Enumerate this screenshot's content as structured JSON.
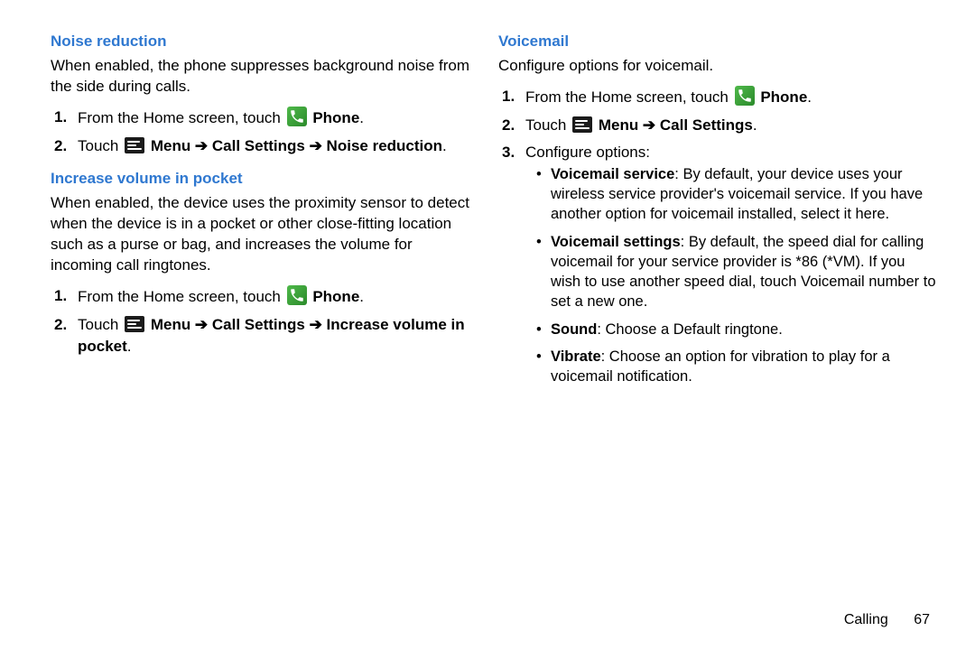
{
  "left": {
    "noise": {
      "heading": "Noise reduction",
      "desc": "When enabled, the phone suppresses background noise from the side during calls.",
      "step1_a": "From the Home screen, touch ",
      "step1_b": "Phone",
      "step2_a": "Touch ",
      "step2_b": "Menu ➔ Call Settings ➔ Noise reduction"
    },
    "pocket": {
      "heading": "Increase volume in pocket",
      "desc": "When enabled, the device uses the proximity sensor to detect when the device is in a pocket or other close-fitting location such as a purse or bag, and increases the volume for incoming call ringtones.",
      "step1_a": "From the Home screen, touch ",
      "step1_b": "Phone",
      "step2_a": "Touch ",
      "step2_b": "Menu ➔ Call Settings ➔ Increase volume in pocket"
    }
  },
  "right": {
    "heading": "Voicemail",
    "desc": "Configure options for voicemail.",
    "step1_a": "From the Home screen, touch ",
    "step1_b": "Phone",
    "step2_a": "Touch ",
    "step2_b": "Menu ➔ Call Settings",
    "step3": "Configure options:",
    "bullets": {
      "b1_label": "Voicemail service",
      "b1_text": ": By default, your device uses your wireless service provider's voicemail service. If you have another option for voicemail installed, select it here.",
      "b2_label": "Voicemail settings",
      "b2_text": ": By default, the speed dial for calling voicemail for your service provider is *86 (*VM). If you wish to use another speed dial, touch Voicemail number to set a new one.",
      "b3_label": "Sound",
      "b3_text": ": Choose a Default ringtone.",
      "b4_label": "Vibrate",
      "b4_text": ": Choose an option for vibration to play for a voicemail notification."
    }
  },
  "footer": {
    "section": "Calling",
    "page": "67"
  },
  "nums": {
    "n1": "1.",
    "n2": "2.",
    "n3": "3."
  },
  "period": "."
}
